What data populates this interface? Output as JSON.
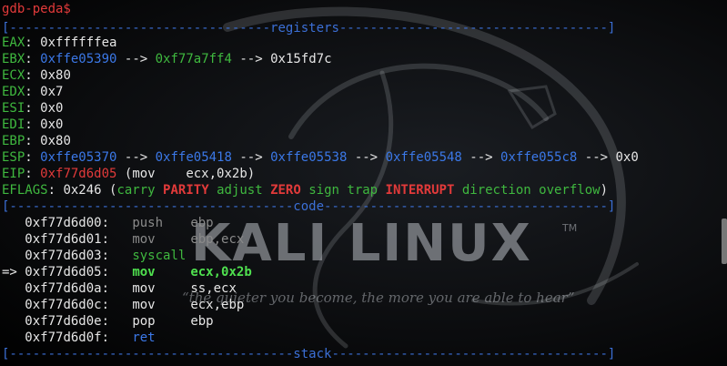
{
  "prompt": "gdb-peda$",
  "sections": {
    "registers": "registers",
    "code": "code",
    "stack": "stack"
  },
  "registers": {
    "eax": {
      "name": "EAX",
      "value": "0xffffffea"
    },
    "ebx": {
      "name": "EBX",
      "v1": "0xffe05390",
      "v2": "0xf77a7ff4",
      "v3": "0x15fd7c"
    },
    "ecx": {
      "name": "ECX",
      "value": "0x80"
    },
    "edx": {
      "name": "EDX",
      "value": "0x7"
    },
    "esi": {
      "name": "ESI",
      "value": "0x0"
    },
    "edi": {
      "name": "EDI",
      "value": "0x0"
    },
    "ebp": {
      "name": "EBP",
      "value": "0x80"
    },
    "esp": {
      "name": "ESP",
      "v1": "0xffe05370",
      "v2": "0xffe05418",
      "v3": "0xffe05538",
      "v4": "0xffe05548",
      "v5": "0xffe055c8",
      "v6": "0x0"
    },
    "eip": {
      "name": "EIP",
      "addr": "0xf77d6d05",
      "instr": "(mov    ecx,0x2b)"
    },
    "eflags": {
      "name": "EFLAGS",
      "value": "0x246",
      "flags": [
        "carry",
        "PARITY",
        "adjust",
        "ZERO",
        "sign",
        "trap",
        "INTERRUPT",
        "direction",
        "overflow"
      ]
    }
  },
  "arrow": "-->",
  "code": [
    {
      "marker": "",
      "addr": "0xf77d6d00:",
      "op": "push",
      "args": "ebp"
    },
    {
      "marker": "",
      "addr": "0xf77d6d01:",
      "op": "mov",
      "args": "ebp,ecx"
    },
    {
      "marker": "",
      "addr": "0xf77d6d03:",
      "op": "syscall",
      "args": ""
    },
    {
      "marker": "=>",
      "addr": "0xf77d6d05:",
      "op": "mov",
      "args": "ecx,0x2b"
    },
    {
      "marker": "",
      "addr": "0xf77d6d0a:",
      "op": "mov",
      "args": "ss,ecx"
    },
    {
      "marker": "",
      "addr": "0xf77d6d0c:",
      "op": "mov",
      "args": "ecx,ebp"
    },
    {
      "marker": "",
      "addr": "0xf77d6d0e:",
      "op": "pop",
      "args": "ebp"
    },
    {
      "marker": "",
      "addr": "0xf77d6d0f:",
      "op": "ret",
      "args": ""
    }
  ],
  "wallpaper": {
    "logo": "KALI LINUX",
    "trademark": "TM",
    "tagline": "“the quieter you become, the more you are able to hear”"
  },
  "colors": {
    "background": "#000000",
    "separator": "#3b6fd6",
    "register_name": "#3fb83f",
    "address": "#3b78e7",
    "highlight_red": "#e23a3a",
    "current_instruction": "#4fe04f"
  }
}
